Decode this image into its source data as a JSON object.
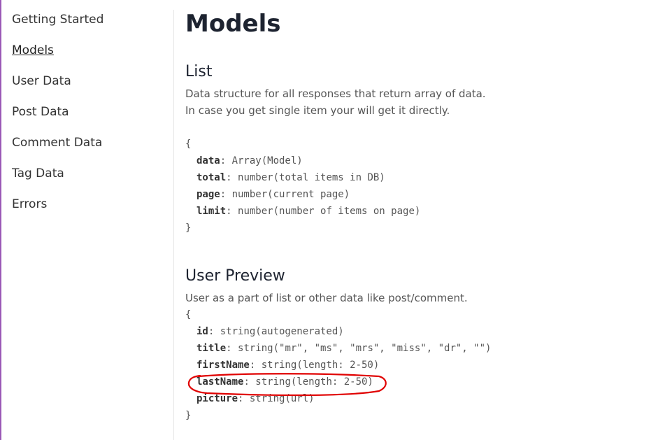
{
  "sidebar": {
    "items": [
      {
        "label": "Getting Started",
        "active": false
      },
      {
        "label": "Models",
        "active": true
      },
      {
        "label": "User Data",
        "active": false
      },
      {
        "label": "Post Data",
        "active": false
      },
      {
        "label": "Comment Data",
        "active": false
      },
      {
        "label": "Tag Data",
        "active": false
      },
      {
        "label": "Errors",
        "active": false
      }
    ]
  },
  "main": {
    "title": "Models",
    "list": {
      "heading": "List",
      "desc_line1": "Data structure for all responses that return array of data.",
      "desc_line2": "In case you get single item your will get it directly.",
      "open_brace": "{",
      "close_brace": "}",
      "fields": [
        {
          "key": "data",
          "value": ": Array(Model)"
        },
        {
          "key": "total",
          "value": ": number(total items in DB)"
        },
        {
          "key": "page",
          "value": ": number(current page)"
        },
        {
          "key": "limit",
          "value": ": number(number of items on page)"
        }
      ]
    },
    "user_preview": {
      "heading": "User Preview",
      "desc": "User as a part of list or other data like post/comment.",
      "open_brace": "{",
      "close_brace": "}",
      "fields": [
        {
          "key": "id",
          "value": ": string(autogenerated)"
        },
        {
          "key": "title",
          "value": ": string(\"mr\", \"ms\", \"mrs\", \"miss\", \"dr\", \"\")"
        },
        {
          "key": "firstName",
          "value": ": string(length: 2-50)"
        },
        {
          "key": "lastName",
          "value": ": string(length: 2-50)"
        },
        {
          "key": "picture",
          "value": ": string(url)"
        }
      ]
    }
  },
  "colors": {
    "annotation": "#e00000",
    "sidebar_edge": "#9b59b6"
  }
}
